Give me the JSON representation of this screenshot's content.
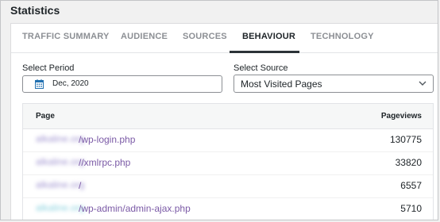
{
  "panel": {
    "title": "Statistics"
  },
  "tabs": [
    {
      "label": "TRAFFIC SUMMARY",
      "active": false
    },
    {
      "label": "AUDIENCE",
      "active": false
    },
    {
      "label": "SOURCES",
      "active": false
    },
    {
      "label": "BEHAVIOUR",
      "active": true
    },
    {
      "label": "TECHNOLOGY",
      "active": false
    }
  ],
  "filters": {
    "period_label": "Select Period",
    "period_value": "Dec, 2020",
    "source_label": "Select Source",
    "source_value": "Most Visited Pages"
  },
  "table": {
    "col_page": "Page",
    "col_views": "Pageviews",
    "rows": [
      {
        "domain": "alkaline.org",
        "path": "/wp-login.php",
        "views": "130775"
      },
      {
        "domain": "alkaline.org",
        "path": "//xmlrpc.php",
        "views": "33820"
      },
      {
        "domain": "alkaline.org",
        "path": "/",
        "views": "6557"
      },
      {
        "domain": "alkaline.org",
        "path": "/wp-admin/admin-ajax.php",
        "views": "5710"
      }
    ]
  },
  "icons": {
    "calendar": "calendar-icon",
    "chevron": "chevron-down-icon"
  },
  "colors": {
    "accent_link": "#7b5aa6",
    "active_tab": "#1d2327",
    "inactive_tab": "#8c8f94",
    "calendar_icon": "#2271b1"
  }
}
